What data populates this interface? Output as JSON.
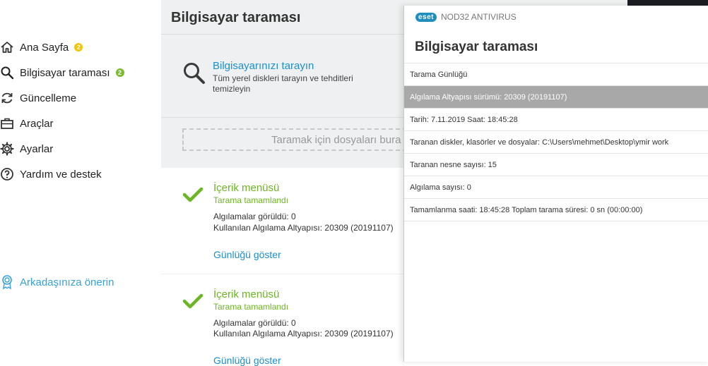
{
  "sidebar": {
    "items": [
      {
        "label": "Ana Sayfa",
        "icon": "home-icon",
        "badge": "2",
        "badge_color": "#f4c400"
      },
      {
        "label": "Bilgisayar taraması",
        "icon": "search-icon",
        "badge": "2",
        "badge_color": "#7cba2e"
      },
      {
        "label": "Güncelleme",
        "icon": "refresh-icon"
      },
      {
        "label": "Araçlar",
        "icon": "briefcase-icon"
      },
      {
        "label": "Ayarlar",
        "icon": "gear-icon"
      },
      {
        "label": "Yardım ve destek",
        "icon": "help-icon"
      }
    ],
    "refer": {
      "label": "Arkadaşınıza önerin",
      "icon": "ribbon-icon"
    }
  },
  "main": {
    "title": "Bilgisayar taraması",
    "scan": {
      "link": "Bilgisayarınızı tarayın",
      "description": "Tüm yerel diskleri tarayın ve tehditleri temizleyin"
    },
    "drop_zone": "Taramak için dosyaları bura",
    "results": [
      {
        "title": "İçerik menüsü",
        "status": "Tarama tamamlandı",
        "detections": "Algılamalar görüldü: 0",
        "engine": "Kullanılan Algılama Altyapısı: 20309 (20191107)",
        "link": "Günlüğü göster"
      },
      {
        "title": "İçerik menüsü",
        "status": "Tarama tamamlandı",
        "detections": "Algılamalar görüldü: 0",
        "engine": "Kullanılan Algılama Altyapısı: 20309 (20191107)",
        "link": "Günlüğü göster"
      }
    ]
  },
  "log_window": {
    "brand": "eset",
    "product": "NOD32 ANTIVIRUS",
    "title": "Bilgisayar taraması",
    "rows": [
      "Tarama Günlüğü",
      "Algılama Altyapısı sürümü: 20309 (20191107)",
      "Tarih: 7.11.2019  Saat: 18:45:28",
      "Taranan diskler, klasörler ve dosyalar: C:\\Users\\mehmet\\Desktop\\ymir work",
      "Taranan nesne sayısı: 15",
      "Algılama sayısı: 0",
      "Tamamlanma saati: 18:45:28  Toplam tarama süresi: 0 sn (00:00:00)"
    ],
    "selected_row": 1
  },
  "colors": {
    "accent_blue": "#1a8fd1",
    "success_green": "#6cb524",
    "refer_blue": "#34a3d9"
  }
}
